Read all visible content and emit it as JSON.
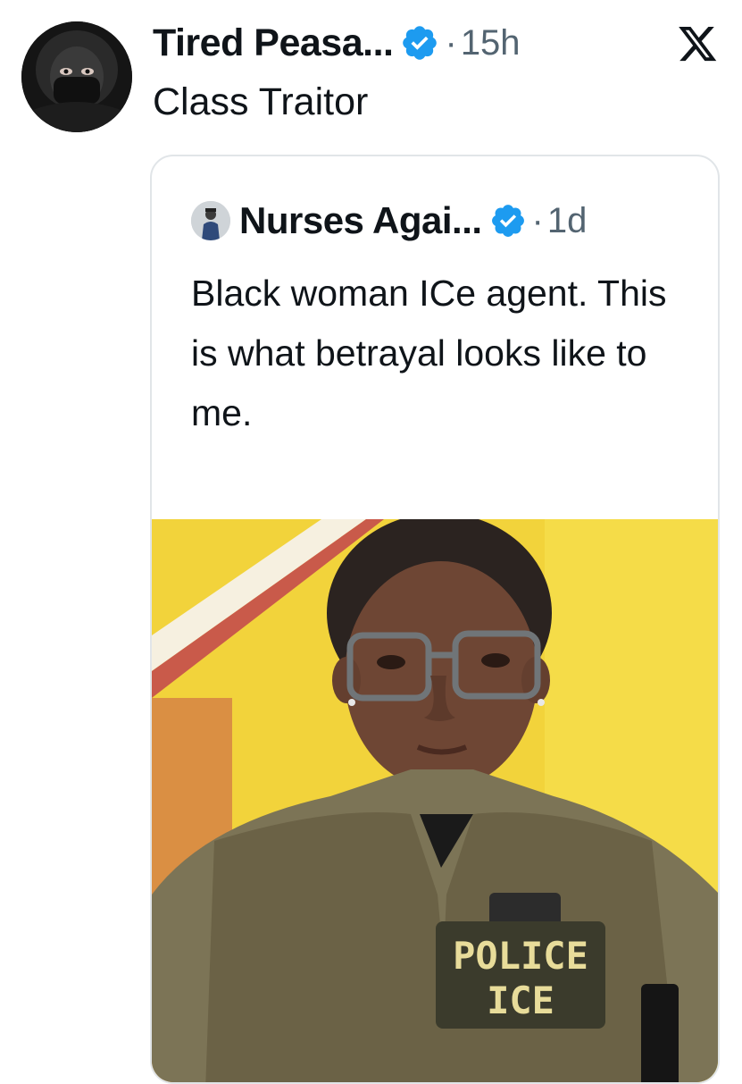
{
  "tweet": {
    "author_name": "Tired Peasa...",
    "verified": true,
    "separator": "·",
    "time": "15h",
    "text": "Class Traitor"
  },
  "quoted_tweet": {
    "author_name": "Nurses Agai...",
    "verified": true,
    "separator": "·",
    "time": "1d",
    "text": "Black woman ICe agent. This is what betrayal looks like to me.",
    "image": {
      "patch_text_line1": "POLICE",
      "patch_text_line2": "ICE"
    }
  },
  "icons": {
    "platform_logo": "x-logo-icon",
    "verified_badge": "verified-badge-icon"
  },
  "colors": {
    "verified_blue": "#1d9bf0",
    "muted_text": "#536471",
    "background_yellow": "#f2d33b"
  }
}
